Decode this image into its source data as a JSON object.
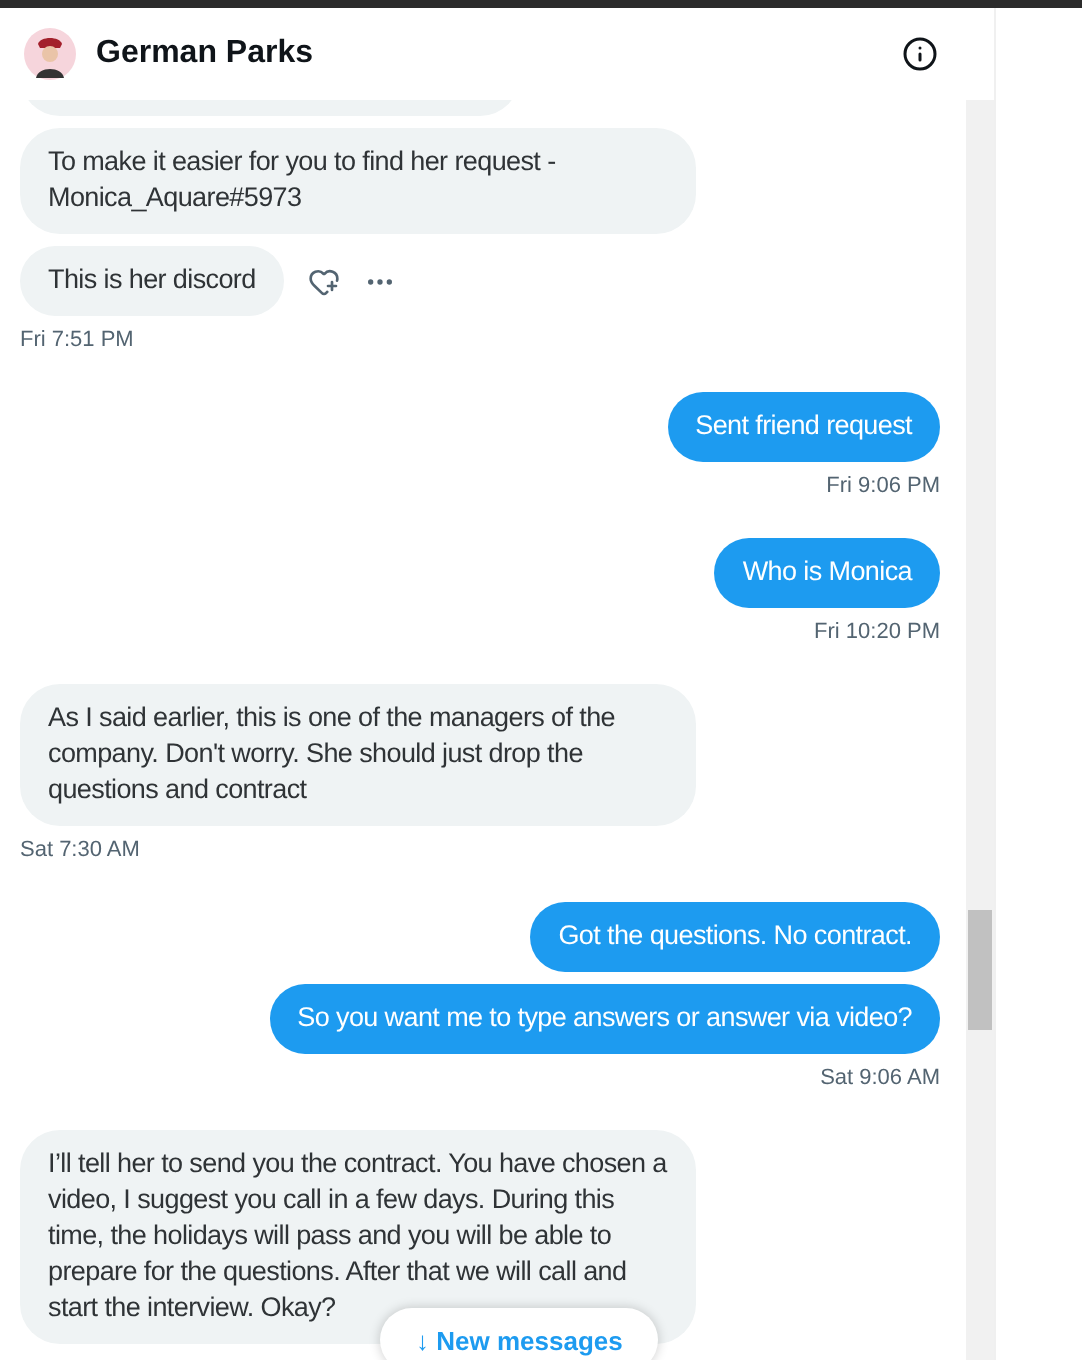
{
  "header": {
    "name": "German Parks"
  },
  "messages": [
    {
      "kind": "stub",
      "sent": false
    },
    {
      "kind": "message",
      "sent": false,
      "text": "To make it easier for you to find her request - Monica_Aquare#5973",
      "show_actions": false
    },
    {
      "kind": "message",
      "sent": false,
      "text": "This is her discord",
      "show_actions": true
    },
    {
      "kind": "timestamp",
      "sent": false,
      "text": "Fri 7:51 PM"
    },
    {
      "kind": "message",
      "sent": true,
      "text": "Sent friend request",
      "show_actions": false
    },
    {
      "kind": "timestamp",
      "sent": true,
      "text": "Fri 9:06 PM"
    },
    {
      "kind": "message",
      "sent": true,
      "text": "Who is Monica",
      "show_actions": false
    },
    {
      "kind": "timestamp",
      "sent": true,
      "text": "Fri 10:20 PM"
    },
    {
      "kind": "message",
      "sent": false,
      "text": "As I said earlier, this is one of the managers of the company. Don't worry. She should just drop the questions and contract",
      "show_actions": false
    },
    {
      "kind": "timestamp",
      "sent": false,
      "text": "Sat 7:30 AM"
    },
    {
      "kind": "message",
      "sent": true,
      "text": "Got the questions. No contract.",
      "show_actions": false
    },
    {
      "kind": "message",
      "sent": true,
      "text": "So you want me to type answers or answer via video?",
      "show_actions": false
    },
    {
      "kind": "timestamp",
      "sent": true,
      "text": "Sat 9:06 AM"
    },
    {
      "kind": "message",
      "sent": false,
      "text": "I’ll tell her to send you the contract. You have chosen a video, I suggest you call in a few days. During this time, the holidays will pass and you will be able to prepare for the questions. After that we will call and start the interview. Okay?",
      "show_actions": false
    }
  ],
  "new_messages": {
    "arrow": "↓",
    "label": "New messages"
  }
}
